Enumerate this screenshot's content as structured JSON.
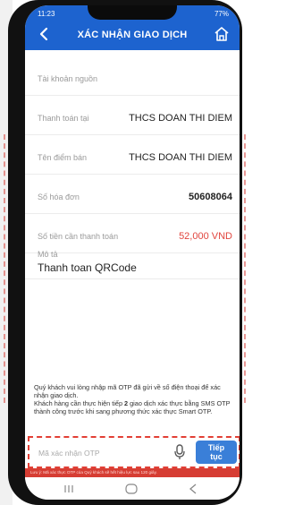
{
  "status_bar": {
    "time": "11:23",
    "battery": "77%"
  },
  "header": {
    "title": "XÁC NHẬN GIAO DỊCH"
  },
  "rows": [
    {
      "label": "Tài khoản nguồn",
      "value": ""
    },
    {
      "label": "Thanh toán tại",
      "value": "THCS DOAN THI DIEM"
    },
    {
      "label": "Tên điểm bán",
      "value": "THCS DOAN THI DIEM"
    },
    {
      "label": "Số hóa đơn",
      "value": "50608064"
    },
    {
      "label": "Số tiền cần thanh toán",
      "value": "52,000 VND"
    }
  ],
  "description": {
    "label": "Mô tả",
    "value": "Thanh toan QRCode"
  },
  "note": {
    "line1": "Quý khách vui lòng nhập mã OTP đã gửi về số điện thoại để xác nhận giao dịch.",
    "line2_pre": "Khách hàng cần thực hiện tiếp ",
    "line2_bold": "2",
    "line2_post": " giao dịch xác thực bằng SMS OTP thành công trước khi sang phương thức xác thực Smart OTP."
  },
  "otp": {
    "placeholder": "Mã xác nhận OTP",
    "button": "Tiếp tục"
  },
  "expiry_bar": "Lưu ý: Mã xác thực OTP của Quý khách sẽ hết hiệu lực sau 120 giây.",
  "colors": {
    "header": "#1d63cf",
    "amount": "#e1453e",
    "button": "#3a7fd8",
    "expiry_bar": "#d63d33"
  },
  "icons": [
    "back-icon",
    "home-icon",
    "microphone-icon",
    "recent-apps-icon",
    "home-circle-icon",
    "back-triangle-icon"
  ]
}
